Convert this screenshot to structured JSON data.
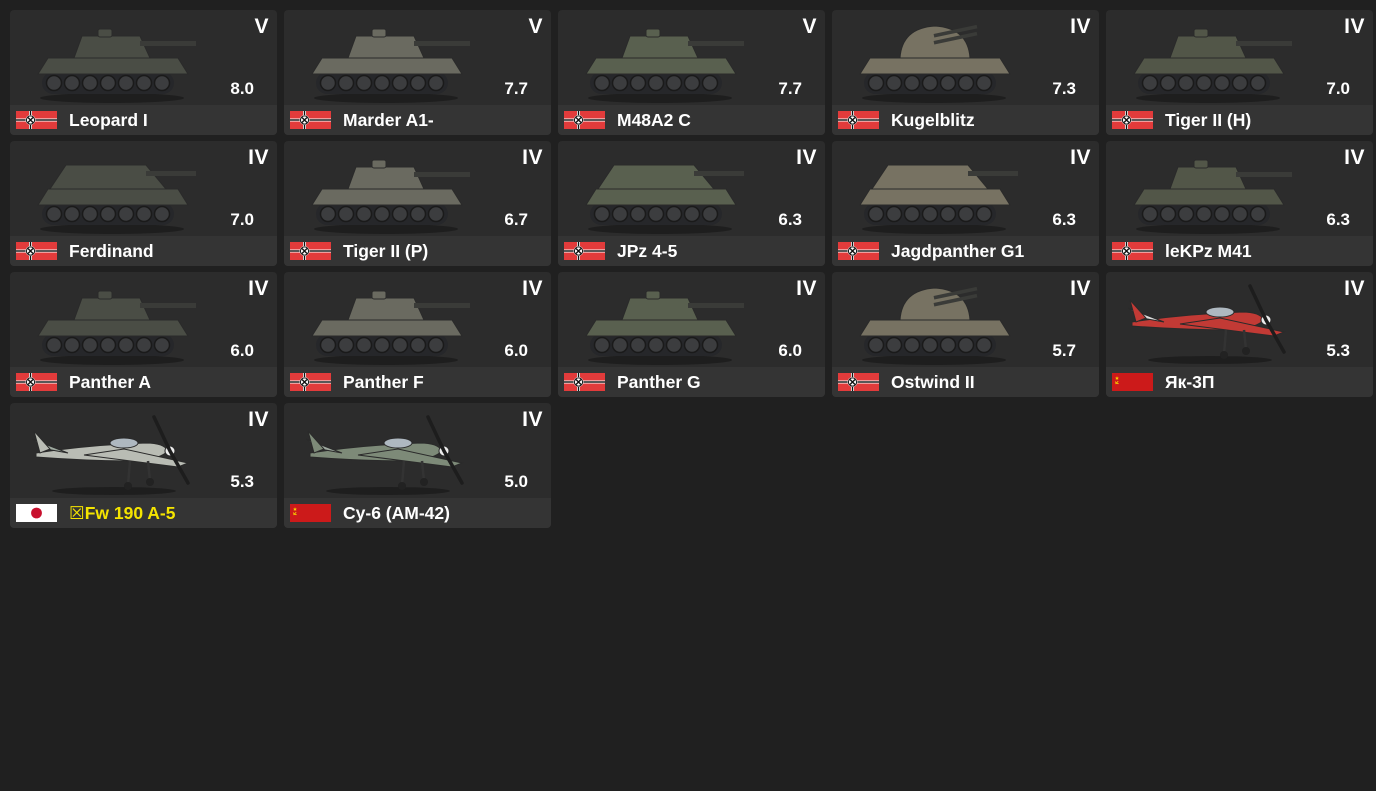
{
  "colors": {
    "background": "#202020",
    "card": "#2c2c2c",
    "name_premium": "#f4e400",
    "german_flag_red": "#e23b3b",
    "ussr_flag_red": "#cc1a1a",
    "japan_flag_red": "#c8102e"
  },
  "vehicles": [
    {
      "rank": "V",
      "br": "8.0",
      "name": "Leopard I",
      "nation": "germany",
      "type": "tank",
      "icon": "tank-icon",
      "premium": false
    },
    {
      "rank": "V",
      "br": "7.7",
      "name": "Marder A1-",
      "nation": "germany",
      "type": "tank",
      "icon": "tank-icon",
      "premium": false
    },
    {
      "rank": "V",
      "br": "7.7",
      "name": "M48A2 C",
      "nation": "germany",
      "type": "tank",
      "icon": "tank-icon",
      "premium": false
    },
    {
      "rank": "IV",
      "br": "7.3",
      "name": "Kugelblitz",
      "nation": "germany",
      "type": "spaa",
      "icon": "spaa-icon",
      "premium": false
    },
    {
      "rank": "IV",
      "br": "7.0",
      "name": "Tiger II (H)",
      "nation": "germany",
      "type": "tank",
      "icon": "tank-icon",
      "premium": false
    },
    {
      "rank": "IV",
      "br": "7.0",
      "name": "Ferdinand",
      "nation": "germany",
      "type": "td",
      "icon": "tank-destroyer-icon",
      "premium": false
    },
    {
      "rank": "IV",
      "br": "6.7",
      "name": "Tiger II (P)",
      "nation": "germany",
      "type": "tank",
      "icon": "tank-icon",
      "premium": false
    },
    {
      "rank": "IV",
      "br": "6.3",
      "name": "JPz 4-5",
      "nation": "germany",
      "type": "td",
      "icon": "tank-destroyer-icon",
      "premium": false
    },
    {
      "rank": "IV",
      "br": "6.3",
      "name": "Jagdpanther G1",
      "nation": "germany",
      "type": "td",
      "icon": "tank-destroyer-icon",
      "premium": false
    },
    {
      "rank": "IV",
      "br": "6.3",
      "name": "leKPz M41",
      "nation": "germany",
      "type": "tank",
      "icon": "tank-icon",
      "premium": false
    },
    {
      "rank": "IV",
      "br": "6.0",
      "name": "Panther A",
      "nation": "germany",
      "type": "tank",
      "icon": "tank-icon",
      "premium": false
    },
    {
      "rank": "IV",
      "br": "6.0",
      "name": "Panther F",
      "nation": "germany",
      "type": "tank",
      "icon": "tank-icon",
      "premium": false
    },
    {
      "rank": "IV",
      "br": "6.0",
      "name": "Panther G",
      "nation": "germany",
      "type": "tank",
      "icon": "tank-icon",
      "premium": false
    },
    {
      "rank": "IV",
      "br": "5.7",
      "name": "Ostwind II",
      "nation": "germany",
      "type": "spaa",
      "icon": "spaa-icon",
      "premium": false
    },
    {
      "rank": "IV",
      "br": "5.3",
      "name": "Як-3П",
      "nation": "ussr",
      "type": "plane",
      "icon": "plane-icon",
      "premium": false
    },
    {
      "rank": "IV",
      "br": "5.3",
      "name": "☒Fw 190 A-5",
      "nation": "japan",
      "type": "plane",
      "icon": "plane-icon",
      "premium": true
    },
    {
      "rank": "IV",
      "br": "5.0",
      "name": "Су-6 (АМ-42)",
      "nation": "ussr",
      "type": "plane",
      "icon": "plane-icon",
      "premium": false
    }
  ]
}
